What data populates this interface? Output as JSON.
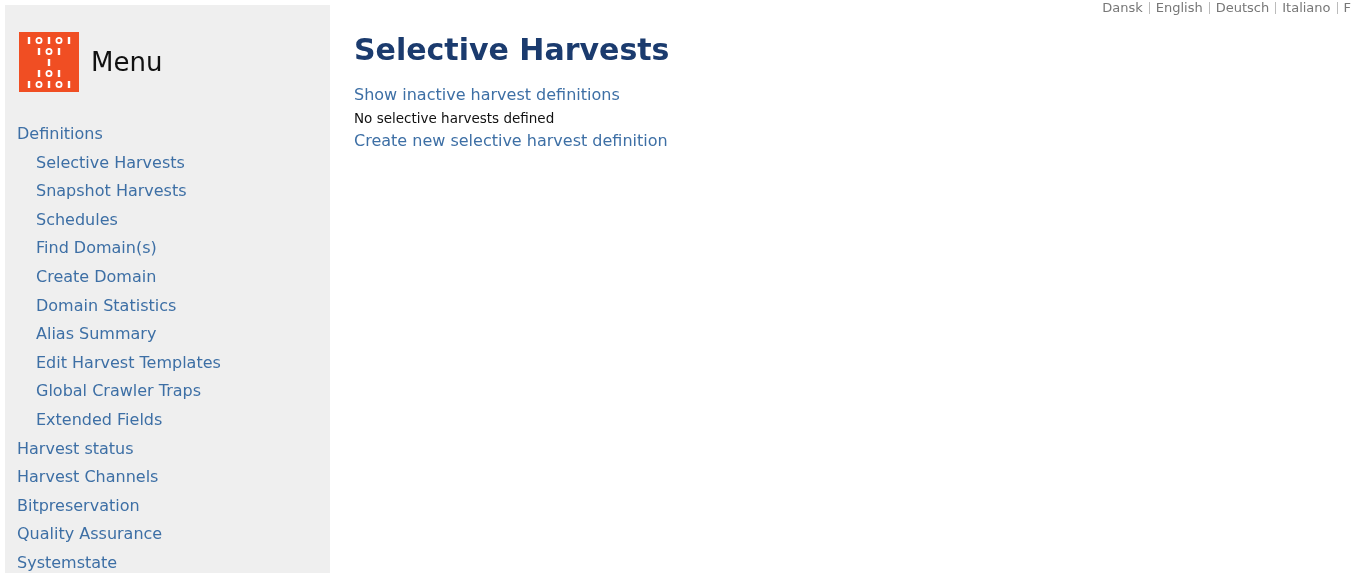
{
  "languages": [
    "Dansk",
    "English",
    "Deutsch",
    "Italiano",
    "F"
  ],
  "sidebar": {
    "title": "Menu",
    "items": [
      {
        "label": "Definitions",
        "children": [
          {
            "label": "Selective Harvests"
          },
          {
            "label": "Snapshot Harvests"
          },
          {
            "label": "Schedules"
          },
          {
            "label": "Find Domain(s)"
          },
          {
            "label": "Create Domain"
          },
          {
            "label": "Domain Statistics"
          },
          {
            "label": "Alias Summary"
          },
          {
            "label": "Edit Harvest Templates"
          },
          {
            "label": "Global Crawler Traps"
          },
          {
            "label": "Extended Fields"
          }
        ]
      },
      {
        "label": "Harvest status"
      },
      {
        "label": "Harvest Channels"
      },
      {
        "label": "Bitpreservation"
      },
      {
        "label": "Quality Assurance"
      },
      {
        "label": "Systemstate"
      }
    ]
  },
  "main": {
    "title": "Selective Harvests",
    "show_inactive_link": "Show inactive harvest definitions",
    "message": "No selective harvests defined",
    "create_link": "Create new selective harvest definition"
  }
}
